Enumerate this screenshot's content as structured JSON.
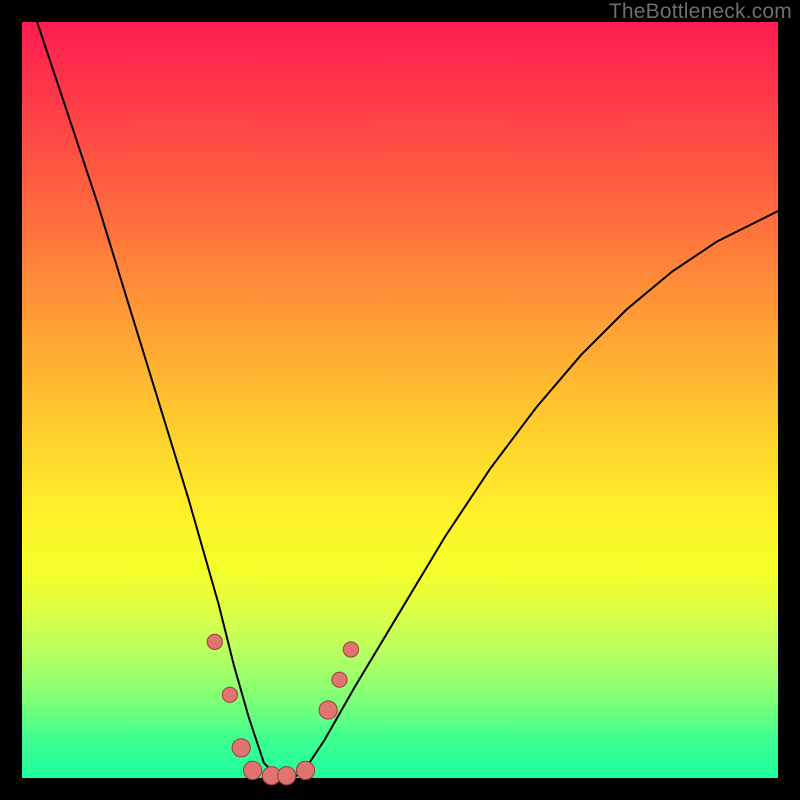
{
  "watermark": "TheBottleneck.com",
  "colors": {
    "frame_bg_top": "#ff1d52",
    "frame_bg_bottom": "#1effa0",
    "curve": "#000000",
    "dot_fill": "#e07470",
    "dot_stroke": "#9a3d3a",
    "page_bg": "#000000"
  },
  "chart_data": {
    "type": "line",
    "title": "",
    "xlabel": "",
    "ylabel": "",
    "xlim": [
      0,
      100
    ],
    "ylim": [
      0,
      100
    ],
    "note": "Axes are implicit (no tick labels). y≈0 at bottom (green) = best match; y≈100 at top (red) = worst. x is an unlabeled parameter. Curve is a sharp V with minimum near x≈32–36.",
    "series": [
      {
        "name": "bottleneck-curve",
        "x": [
          2,
          6,
          10,
          14,
          18,
          22,
          26,
          28,
          30,
          32,
          34,
          36,
          38,
          40,
          44,
          50,
          56,
          62,
          68,
          74,
          80,
          86,
          92,
          98,
          100
        ],
        "values": [
          100,
          88,
          76,
          63,
          50,
          37,
          23,
          15,
          8,
          2,
          0,
          0,
          2,
          5,
          12,
          22,
          32,
          41,
          49,
          56,
          62,
          67,
          71,
          74,
          75
        ]
      }
    ],
    "markers": [
      {
        "x": 25.5,
        "y": 18,
        "r": 1.0,
        "label": "left-upper"
      },
      {
        "x": 27.5,
        "y": 11,
        "r": 1.0,
        "label": "left-mid"
      },
      {
        "x": 29.0,
        "y": 4,
        "r": 1.2,
        "label": "left-lower"
      },
      {
        "x": 30.5,
        "y": 1,
        "r": 1.2,
        "label": "bottom-left"
      },
      {
        "x": 33.0,
        "y": 0.3,
        "r": 1.2,
        "label": "bottom-mid-1"
      },
      {
        "x": 35.0,
        "y": 0.3,
        "r": 1.2,
        "label": "bottom-mid-2"
      },
      {
        "x": 37.5,
        "y": 1,
        "r": 1.2,
        "label": "bottom-right"
      },
      {
        "x": 40.5,
        "y": 9,
        "r": 1.2,
        "label": "right-lower"
      },
      {
        "x": 42.0,
        "y": 13,
        "r": 1.0,
        "label": "right-mid"
      },
      {
        "x": 43.5,
        "y": 17,
        "r": 1.0,
        "label": "right-upper"
      }
    ]
  }
}
